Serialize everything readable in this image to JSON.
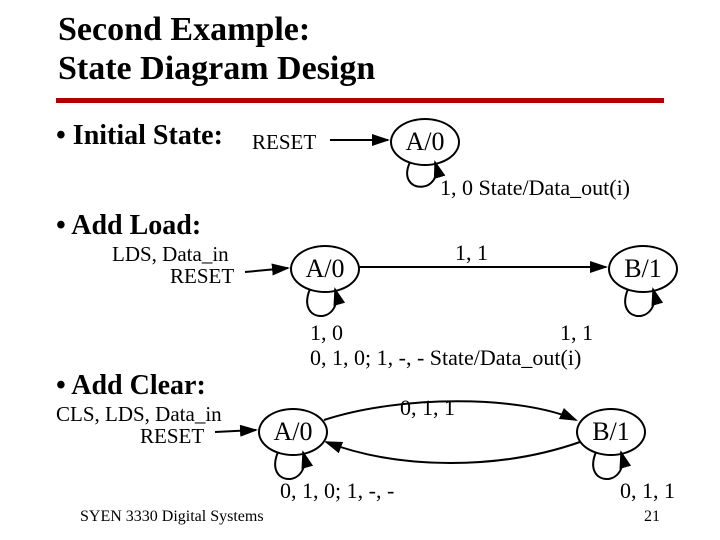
{
  "title_line1": "Second Example:",
  "title_line2": "State Diagram Design",
  "bullets": {
    "initial": "•  Initial State:",
    "addload": "•  Add Load:",
    "addclear": "•  Add Clear:"
  },
  "reset_label": "RESET",
  "addload_sub": "LDS, Data_in",
  "addclear_sub": "CLS, LDS, Data_in",
  "states": {
    "a": "A/0",
    "b": "B/1"
  },
  "labels": {
    "row1_right": "1, 0  State/Data_out(i)",
    "row2_mid": "1, 1",
    "row2_left_loop": "1, 0",
    "row2_right_loop": "1, 1",
    "row2_bottom": "0, 1, 0; 1, -, -  State/Data_out(i)",
    "row3_top": "0, 1, 1",
    "row3_left_loop": "0, 1, 0; 1, -, -",
    "row3_right_loop": "0, 1, 1"
  },
  "footer": {
    "left": "SYEN 3330  Digital Systems",
    "right": "21"
  }
}
